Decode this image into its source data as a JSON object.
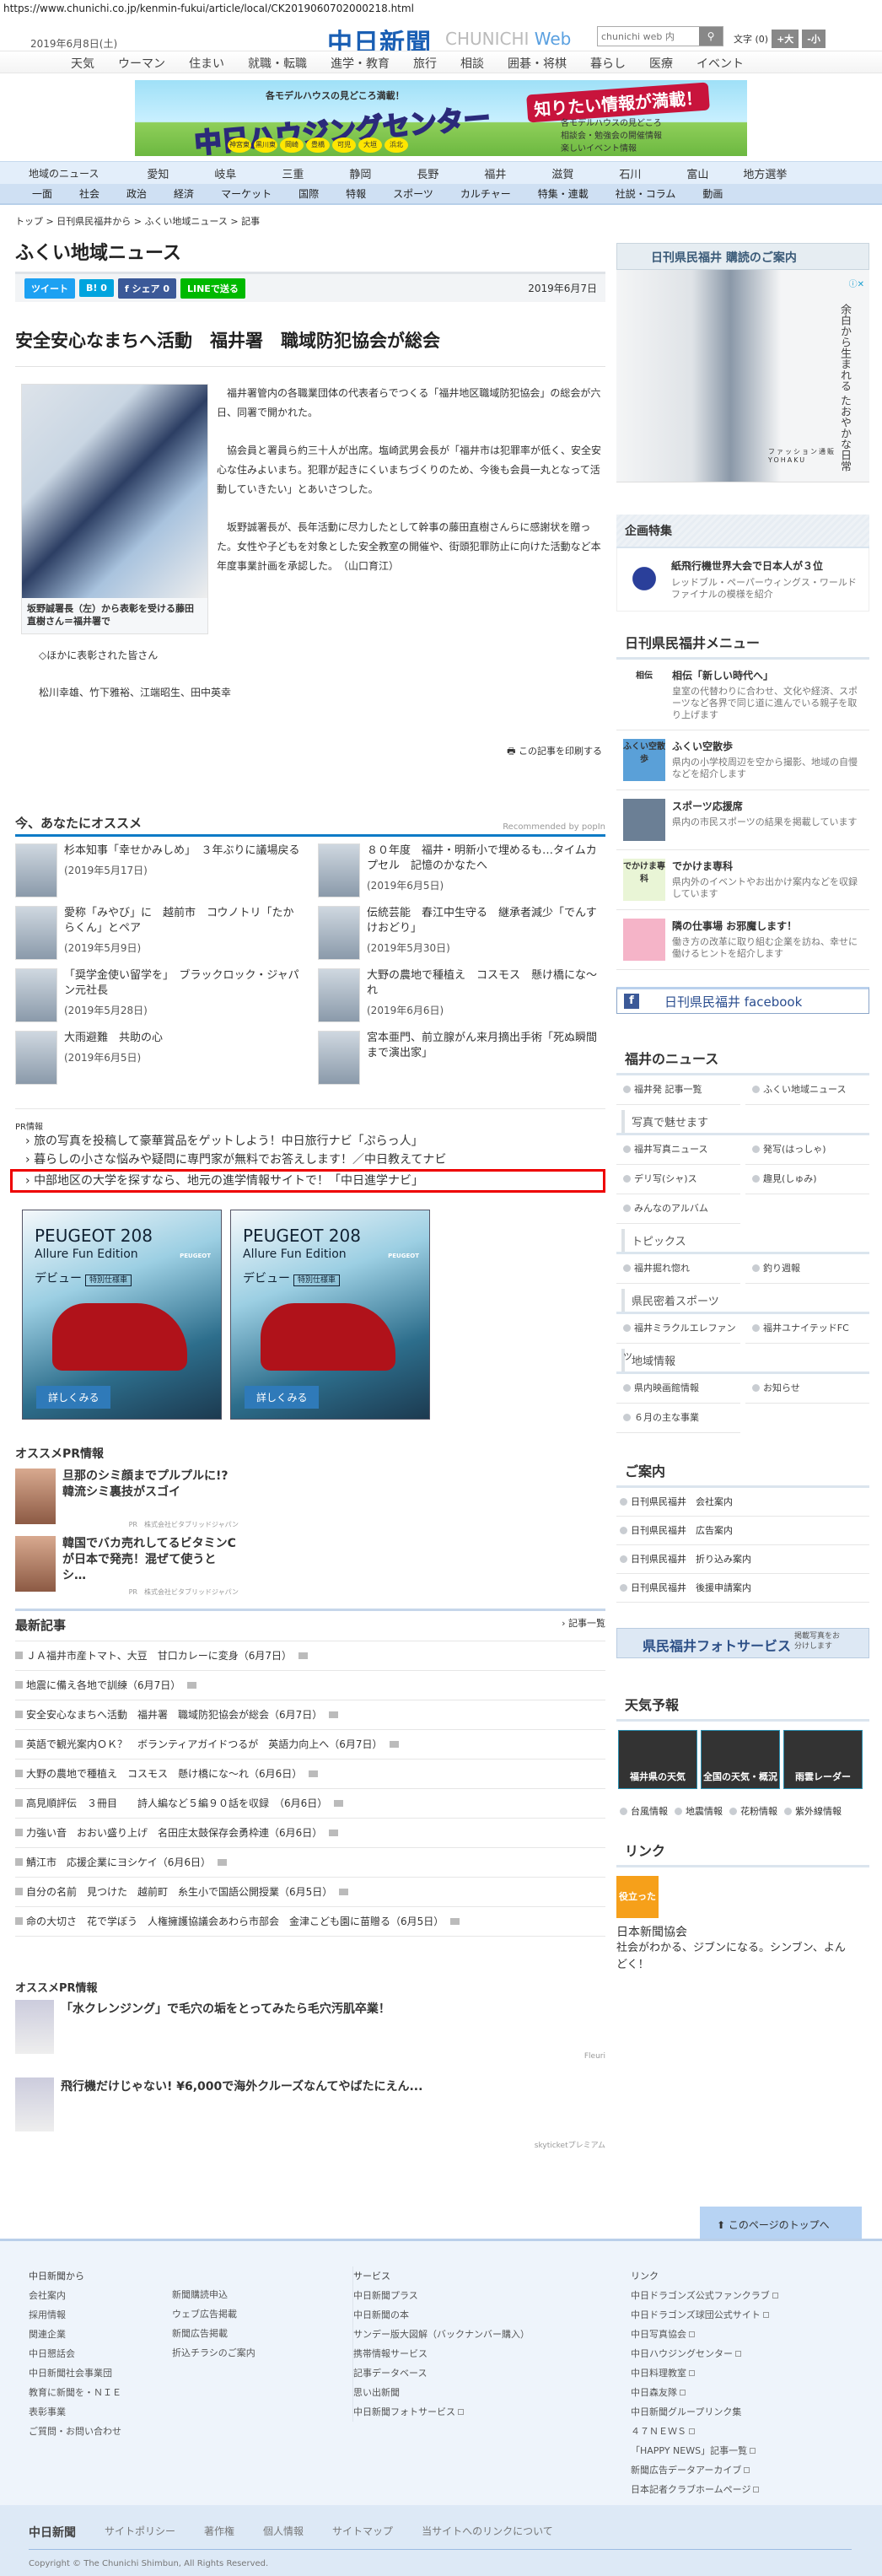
{
  "url": "https://www.chunichi.co.jp/kenmin-fukui/article/local/CK2019060702000218.html",
  "header": {
    "date": "2019年6月8日(土)",
    "logo": "中日新聞",
    "logo_en_a": "CHUNICHI",
    "logo_en_b": "Web",
    "search_placeholder": "chunichi web 内",
    "font_label": "文字 (0)",
    "font_up": "+大",
    "font_down": "-小",
    "topnav": [
      "天気",
      "ウーマン",
      "住まい",
      "就職・転職",
      "進学・教育",
      "旅行",
      "相談",
      "囲碁・将棋",
      "暮らし",
      "医療",
      "イベント"
    ]
  },
  "banner": {
    "tagline": "各モデルハウスの見どころ満載！",
    "title": "中日ハウジングセンター",
    "badge": "知りたい情報が満載！",
    "points": [
      "各モデルハウスの見どころ",
      "相談会・勉強会の開催情報",
      "楽しいイベント情報"
    ],
    "towns": [
      "神宮東",
      "黒川東",
      "岡崎",
      "豊橋",
      "可児",
      "大垣",
      "浜北"
    ]
  },
  "regionnav": {
    "label": "地域のニュース",
    "items": [
      "愛知",
      "岐阜",
      "三重",
      "静岡",
      "長野",
      "福井",
      "滋賀",
      "石川",
      "富山",
      "地方選挙"
    ]
  },
  "catnav": [
    "一面",
    "社会",
    "政治",
    "経済",
    "マーケット",
    "国際",
    "特報",
    "スポーツ",
    "カルチャー",
    "特集・連載",
    "社説・コラム",
    "動画"
  ],
  "breadcrumb": "トップ > 日刊県民福井から > ふくい地域ニュース > 記事",
  "page_title": "ふくい地域ニュース",
  "share": {
    "tweet": "ツイート",
    "hatena": "B! 0",
    "fb": "f シェア 0",
    "line": "LINEで送る",
    "date": "2019年6月7日"
  },
  "article": {
    "headline": "安全安心なまちへ活動　福井署　職域防犯協会が総会",
    "caption": "坂野誠署長（左）から表彰を受ける藤田直樹さん＝福井署で",
    "paragraphs": [
      "福井署管内の各職業団体の代表者らでつくる「福井地区職域防犯協会」の総会が六日、同署で開かれた。",
      "協会員と署員ら約三十人が出席。塩崎武男会長が「福井市は犯罪率が低く、安全安心な住みよいまち。犯罪が起きにくいまちづくりのため、今後も会員一丸となって活動していきたい」とあいさつした。",
      "坂野誠署長が、長年活動に尽力したとして幹事の藤田直樹さんらに感謝状を贈った。女性や子どもを対象とした安全教室の開催や、街頭犯罪防止に向けた活動など本年度事業計画を承認した。　（山口育江）"
    ],
    "extra_title": "◇ほかに表彰された皆さん",
    "extra_names": "松川幸雄、竹下雅裕、江端昭生、田中英幸",
    "print": "この記事を印刷する"
  },
  "recommend": {
    "title": "今、あなたにオススメ",
    "by": "Recommended by popIn",
    "items": [
      {
        "title": "杉本知事「幸せかみしめ」　３年ぶりに議場戻る",
        "date": "(2019年5月17日)"
      },
      {
        "title": "８０年度　福井・明新小で埋めるも…タイムカプセル　記憶のかなたへ",
        "date": "(2019年6月5日)"
      },
      {
        "title": "愛称「みやび」に　越前市　コウノトリ「たからくん」とペア",
        "date": "(2019年5月9日)"
      },
      {
        "title": "伝統芸能　春江中生守る　継承者減少「でんすけおどり」",
        "date": "(2019年5月30日)"
      },
      {
        "title": "「奨学金使い留学を」　ブラックロック・ジャパン元社長",
        "date": "(2019年5月28日)"
      },
      {
        "title": "大野の農地で種植え　コスモス　懸け橋にな〜れ",
        "date": "(2019年6月6日)"
      },
      {
        "title": "大雨避難　共助の心",
        "date": "(2019年6月5日)"
      },
      {
        "title": "宮本亜門、前立腺がん来月摘出手術「死ぬ瞬間まで演出家」",
        "date": ""
      }
    ]
  },
  "pr": {
    "label": "PR情報",
    "items": [
      "旅の写真を投稿して豪華賞品をゲットしよう！中日旅行ナビ「ぷらっ人」",
      "暮らしの小さな悩みや疑問に専門家が無料でお答えします！／中日教えてナビ",
      "中部地区の大学を探すなら、地元の進学情報サイトで！「中日進学ナビ」"
    ]
  },
  "ads": [
    {
      "h": "PEUGEOT 208",
      "s": "Allure Fun Edition",
      "d": "デビュー",
      "tag": "特別仕様車",
      "brand": "PEUGEOT",
      "cta": "詳しくみる"
    },
    {
      "h": "PEUGEOT 208",
      "s": "Allure Fun Edition",
      "d": "デビュー",
      "tag": "特別仕様車",
      "brand": "PEUGEOT",
      "cta": "詳しくみる"
    }
  ],
  "osusume": {
    "title": "オススメPR情報",
    "items": [
      {
        "title": "旦那のシミ顔までプルプルに!?韓流シミ裏技がスゴイ",
        "sponsor": "PR　株式会社ビタブリッドジャパン"
      },
      {
        "title": "韓国でバカ売れしてるビタミンCが日本で発売！混ぜて使うとシ…",
        "sponsor": "PR　株式会社ビタブリッドジャパン"
      }
    ]
  },
  "latest": {
    "title": "最新記事",
    "more": "記事一覧",
    "items": [
      "ＪＡ福井市産トマト、大豆　甘口カレーに変身（6月7日）",
      "地震に備え各地で訓練（6月7日）",
      "安全安心なまちへ活動　福井署　職域防犯協会が総会（6月7日）",
      "英語で観光案内ＯＫ？　ボランティアガイドつるが　英語力向上へ（6月7日）",
      "大野の農地で種植え　コスモス　懸け橋にな〜れ（6月6日）",
      "高見順評伝　３冊目　　詩人編など５編９０話を収録　（6月6日）",
      "力強い音　おおい盛り上げ　名田庄太鼓保存会勇枠連（6月6日）",
      "鯖江市　応援企業にヨシケイ（6月6日）",
      "自分の名前　見つけた　越前町　糸生小で国語公開授業（6月5日）",
      "命の大切さ　花で学ぼう　人権擁護協議会あわら市部会　金津こども園に苗贈る（6月5日）"
    ]
  },
  "pr2": {
    "title": "オススメPR情報",
    "items": [
      {
        "title": "「水クレンジング」で毛穴の垢をとってみたら毛穴汚肌卒業！",
        "sponsor": "Fleuri"
      },
      {
        "title": "飛行機だけじゃない! ¥6,000で海外クルーズなんてやばたにえん...",
        "sponsor": "skyticketプレミアム"
      }
    ]
  },
  "side": {
    "subscribe": "日刊県民福井 購読のご案内",
    "ad": {
      "copy": "余白から生まれる たおやかな日常",
      "sub": "ファッション通販",
      "brand": "YOHAKU"
    },
    "kikaku": {
      "title": "企画特集",
      "item_title": "紙飛行機世界大会で日本人が３位",
      "item_desc": "レッドブル・ペーパーウィングス・ワールドファイナルの模様を紹介"
    },
    "menu": {
      "title": "日刊県民福井メニュー",
      "items": [
        {
          "t": "相伝「新しい時代へ」",
          "d": "皇室の代替わりに合わせ、文化や経済、スポーツなど各界で同じ道に進んでいる親子を取り上げます",
          "thumb": "相伝"
        },
        {
          "t": "ふくい空散歩",
          "d": "県内の小学校周辺を空から撮影、地域の自慢などを紹介します",
          "thumb": "ふくい空散歩"
        },
        {
          "t": "スポーツ応援席",
          "d": "県内の市民スポーツの結果を掲載しています",
          "thumb": ""
        },
        {
          "t": "でかけま専科",
          "d": "県内外のイベントやお出かけ案内などを収録しています",
          "thumb": "でかけま専科"
        },
        {
          "t": "隣の仕事場 お邪魔します！",
          "d": "働き方の改革に取り組む企業を訪ね、幸せに働けるヒントを紹介します",
          "thumb": ""
        }
      ]
    },
    "facebook": "日刊県民福井 facebook",
    "fukui_news": {
      "title": "福井のニュース",
      "top": [
        "福井発 記事一覧",
        "ふくい地域ニュース"
      ],
      "groups": [
        {
          "h": "写真で魅せます",
          "items": [
            "福井写真ニュース",
            "発写(はっしゃ)",
            "デリ写(シャ)ス",
            "趣見(しゅみ)",
            "みんなのアルバム"
          ]
        },
        {
          "h": "トピックス",
          "items": [
            "福井掘れ惚れ",
            "釣り週報"
          ]
        },
        {
          "h": "県民密着スポーツ",
          "items": [
            "福井ミラクルエレファンツ",
            "福井ユナイテッドFC"
          ]
        },
        {
          "h": "地域情報",
          "items": [
            "県内映画館情報",
            "お知らせ",
            "６月の主な事業"
          ]
        }
      ]
    },
    "annai": {
      "title": "ご案内",
      "items": [
        "日刊県民福井　会社案内",
        "日刊県民福井　広告案内",
        "日刊県民福井　折り込み案内",
        "日刊県民福井　後援申請案内"
      ]
    },
    "photo_service": {
      "title": "県民福井フォトサービス",
      "sub": "掲載写真をお分けします"
    },
    "weather": {
      "title": "天気予報",
      "tiles": [
        "福井県の天気",
        "全国の天気・概況",
        "雨雲レーダー"
      ],
      "links": [
        "台風情報",
        "地震情報",
        "花粉情報",
        "紫外線情報"
      ]
    },
    "links": {
      "title": "リンク",
      "badge": "役立った",
      "name": "日本新聞協会",
      "desc": "社会がわかる、ジブンになる。シンブン、よんどく！"
    }
  },
  "totop": "このページのトップへ",
  "footer": {
    "col1": {
      "h": "中日新聞から",
      "a": [
        "会社案内",
        "採用情報",
        "関連企業",
        "中日懇話会",
        "中日新聞社会事業団",
        "教育に新聞を・ＮＩＥ",
        "表彰事業",
        "ご質問・お問い合わせ"
      ],
      "b": [
        "新聞購読申込",
        "ウェブ広告掲載",
        "新聞広告掲載",
        "折込チラシのご案内"
      ]
    },
    "col2": {
      "h": "サービス",
      "items": [
        "中日新聞プラス",
        "中日新聞の本",
        "サンデー版大図解（バックナンバー購入）",
        "携帯情報サービス",
        "記事データベース",
        "思い出新聞",
        "中日新聞フォトサービス"
      ]
    },
    "col3": {
      "h": "リンク",
      "items": [
        "中日ドラゴンズ公式ファンクラブ",
        "中日ドラゴンズ球団公式サイト",
        "中日写真協会",
        "中日ハウジングセンター",
        "中日料理教室",
        "中日森友隊",
        "中日新聞グループリンク集",
        "４７ＮＥＷＳ",
        "「HAPPY NEWS」記事一覧",
        "新聞広告データアーカイブ",
        "日本記者クラブホームページ"
      ]
    },
    "bottom": {
      "logo": "中日新聞",
      "links": [
        "サイトポリシー",
        "著作権",
        "個人情報",
        "サイトマップ",
        "当サイトへのリンクについて"
      ],
      "copyright": "Copyright © The Chunichi Shimbun, All Rights Reserved."
    }
  },
  "colors": {
    "brand": "#1a5fb4",
    "accent_blue": "#0c7bc6",
    "highlight": "#ee0000",
    "nav_bg": "#cfe0f3",
    "footer_bg": "#eef4fb"
  }
}
